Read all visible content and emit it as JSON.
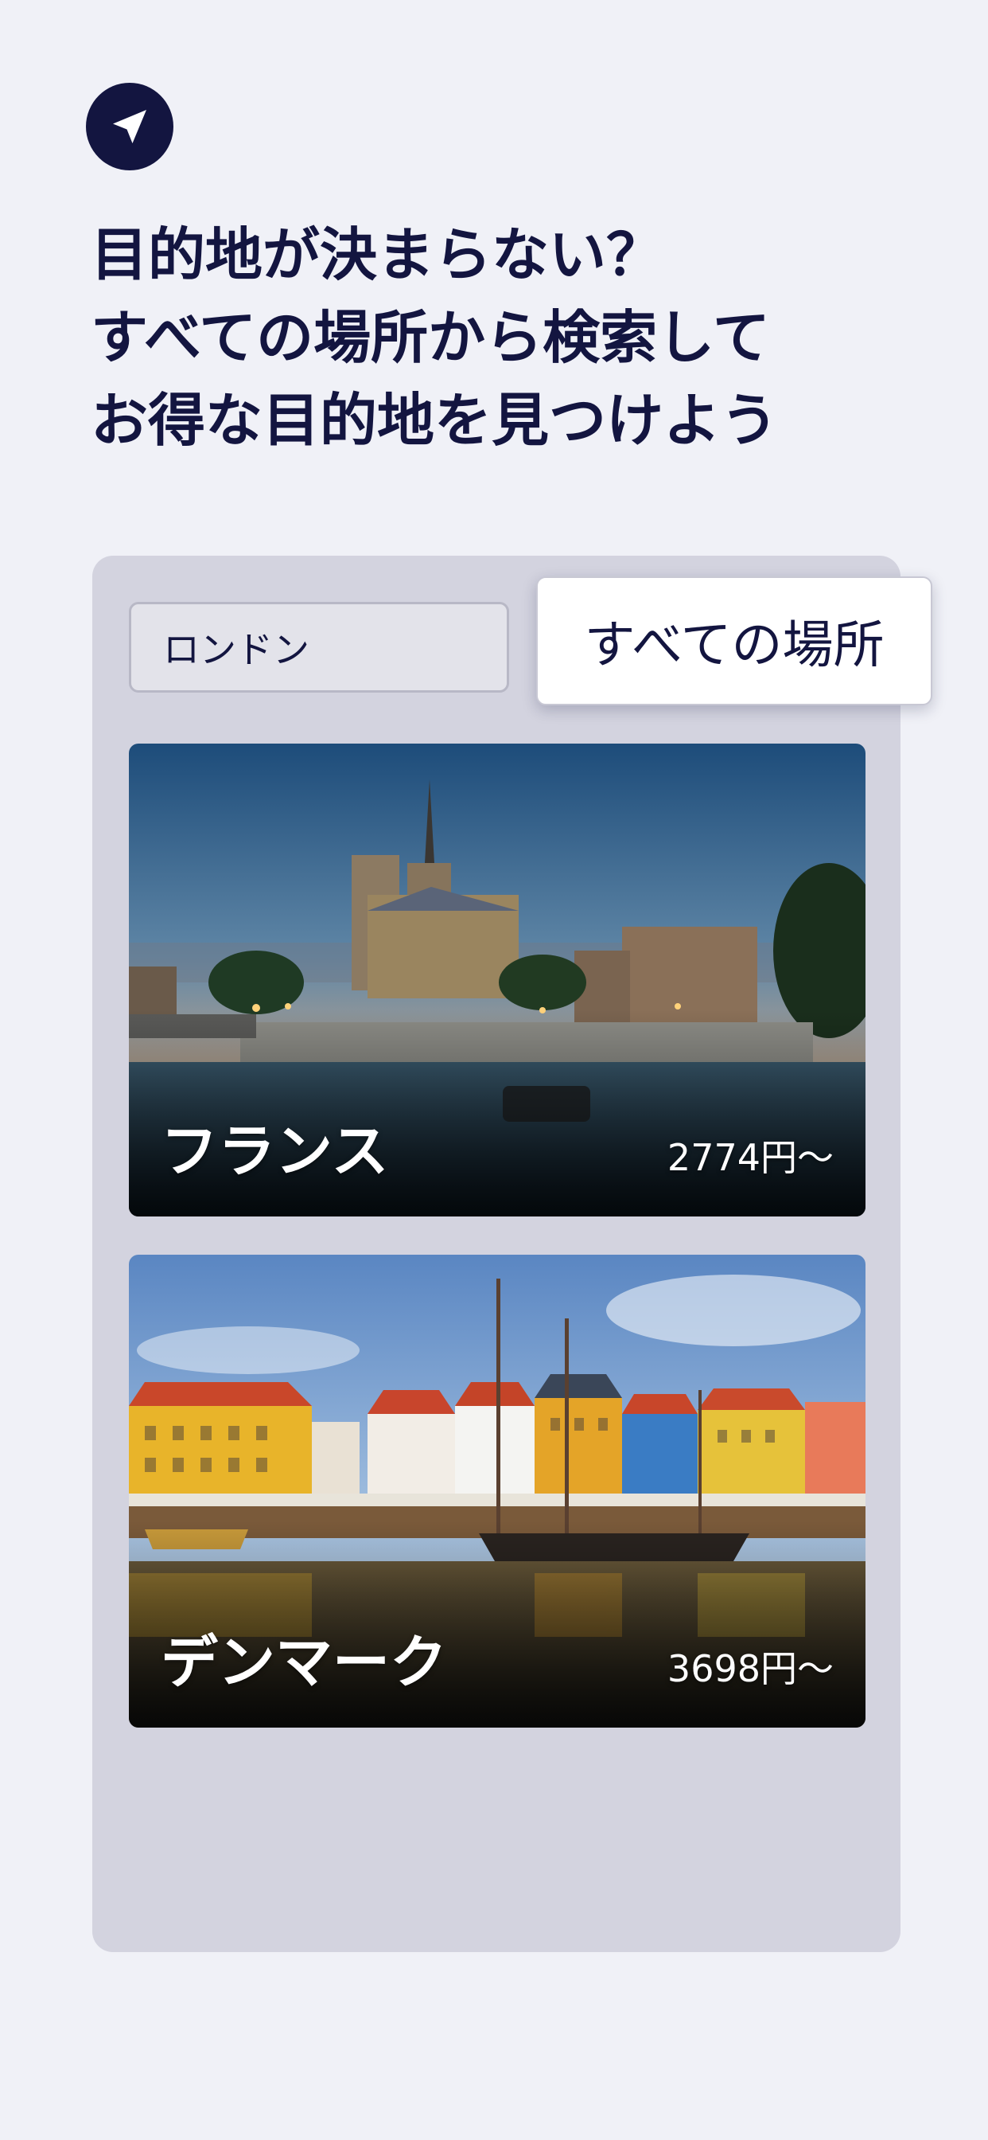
{
  "header": {
    "icon": "location-arrow-icon",
    "headline_lines": [
      "目的地が決まらない？",
      "すべての場所から検索して",
      "お得な目的地を見つけよう"
    ]
  },
  "search": {
    "origin_value": "ロンドン",
    "destination_value": "すべての場所"
  },
  "results": [
    {
      "country": "フランス",
      "price": "2774円〜"
    },
    {
      "country": "デンマーク",
      "price": "3698円〜"
    }
  ],
  "colors": {
    "accent": "#131540",
    "background": "#f0f1f7",
    "panel": "#d3d3df"
  }
}
